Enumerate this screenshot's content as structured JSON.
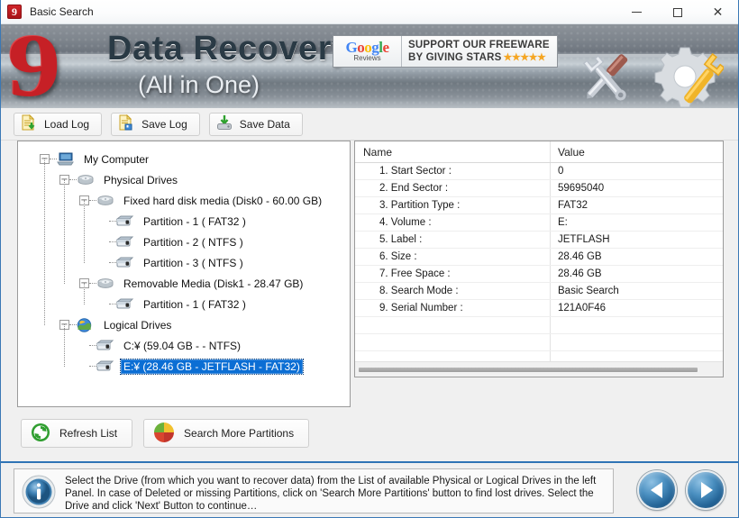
{
  "window": {
    "title": "Basic Search",
    "app_icon": "9",
    "controls": {
      "minimize": "minimize-icon",
      "maximize": "maximize-icon",
      "close": "close-icon"
    }
  },
  "banner": {
    "logo": "9",
    "brand": "Data Recovery",
    "subtitle": "(All in One)",
    "google": {
      "word_g1": "G",
      "word_o1": "o",
      "word_o2": "o",
      "word_g2": "g",
      "word_l": "l",
      "word_e": "e",
      "reviews": "Reviews",
      "line1": "SUPPORT OUR FREEWARE",
      "line2": "BY GIVING STARS",
      "stars": "★★★★★"
    }
  },
  "toolbar": {
    "buttons": [
      {
        "label": "Load Log",
        "icon": "load-log-icon"
      },
      {
        "label": "Save Log",
        "icon": "save-log-icon"
      },
      {
        "label": "Save Data",
        "icon": "save-data-icon"
      }
    ]
  },
  "tree": {
    "nodes": [
      {
        "label": "My Computer",
        "depth": 0,
        "expander": "minus",
        "icon": "computer-icon",
        "selected": false
      },
      {
        "label": "Physical Drives",
        "depth": 1,
        "expander": "minus",
        "icon": "drive-icon",
        "selected": false
      },
      {
        "label": "Fixed hard disk media (Disk0 - 60.00 GB)",
        "depth": 2,
        "expander": "minus",
        "icon": "drive-icon",
        "selected": false
      },
      {
        "label": "Partition - 1 ( FAT32 )",
        "depth": 3,
        "expander": "none",
        "icon": "partition-icon",
        "selected": false
      },
      {
        "label": "Partition - 2 ( NTFS )",
        "depth": 3,
        "expander": "none",
        "icon": "partition-icon",
        "selected": false
      },
      {
        "label": "Partition - 3 ( NTFS )",
        "depth": 3,
        "expander": "none",
        "icon": "partition-icon",
        "selected": false
      },
      {
        "label": "Removable Media (Disk1 - 28.47 GB)",
        "depth": 2,
        "expander": "minus",
        "icon": "drive-icon",
        "selected": false
      },
      {
        "label": "Partition - 1 ( FAT32 )",
        "depth": 3,
        "expander": "none",
        "icon": "partition-icon",
        "selected": false
      },
      {
        "label": "Logical Drives",
        "depth": 1,
        "expander": "minus",
        "icon": "logical-drives-icon",
        "selected": false
      },
      {
        "label": "C:¥ (59.04 GB -  - NTFS)",
        "depth": 2,
        "expander": "none",
        "icon": "partition-icon",
        "selected": false
      },
      {
        "label": "E:¥ (28.46 GB - JETFLASH - FAT32)",
        "depth": 2,
        "expander": "none",
        "icon": "partition-icon",
        "selected": true
      }
    ]
  },
  "details": {
    "columns": {
      "name": "Name",
      "value": "Value"
    },
    "rows": [
      {
        "name": "1. Start Sector :",
        "value": "0"
      },
      {
        "name": "2. End Sector :",
        "value": "59695040"
      },
      {
        "name": "3. Partition Type :",
        "value": "FAT32"
      },
      {
        "name": "4. Volume :",
        "value": "E:"
      },
      {
        "name": "5. Label :",
        "value": "JETFLASH"
      },
      {
        "name": "6. Size :",
        "value": "28.46 GB"
      },
      {
        "name": "7. Free Space :",
        "value": "28.46 GB"
      },
      {
        "name": "8. Search Mode :",
        "value": "Basic Search"
      },
      {
        "name": "9. Serial Number :",
        "value": "121A0F46"
      },
      {
        "name": "",
        "value": ""
      },
      {
        "name": "",
        "value": ""
      },
      {
        "name": "",
        "value": ""
      }
    ]
  },
  "actions": {
    "refresh": {
      "label": "Refresh List",
      "icon": "refresh-icon"
    },
    "search_more": {
      "label": "Search More Partitions",
      "icon": "pie-chart-icon"
    }
  },
  "status": {
    "icon": "info-icon",
    "text": "Select the Drive (from which you want to recover data) from the List of available Physical or Logical Drives in the left Panel. In case of Deleted or missing Partitions, click on 'Search More Partitions' button to find lost drives. Select the Drive and click 'Next' Button to continue…"
  },
  "navigation": {
    "back": {
      "icon": "back-arrow-icon"
    },
    "next": {
      "icon": "next-arrow-icon"
    }
  },
  "colors": {
    "selection": "#0b6ed4",
    "accent": "#2f74b5",
    "logo_red": "#c62026",
    "brand_dark": "#2a3a45"
  }
}
